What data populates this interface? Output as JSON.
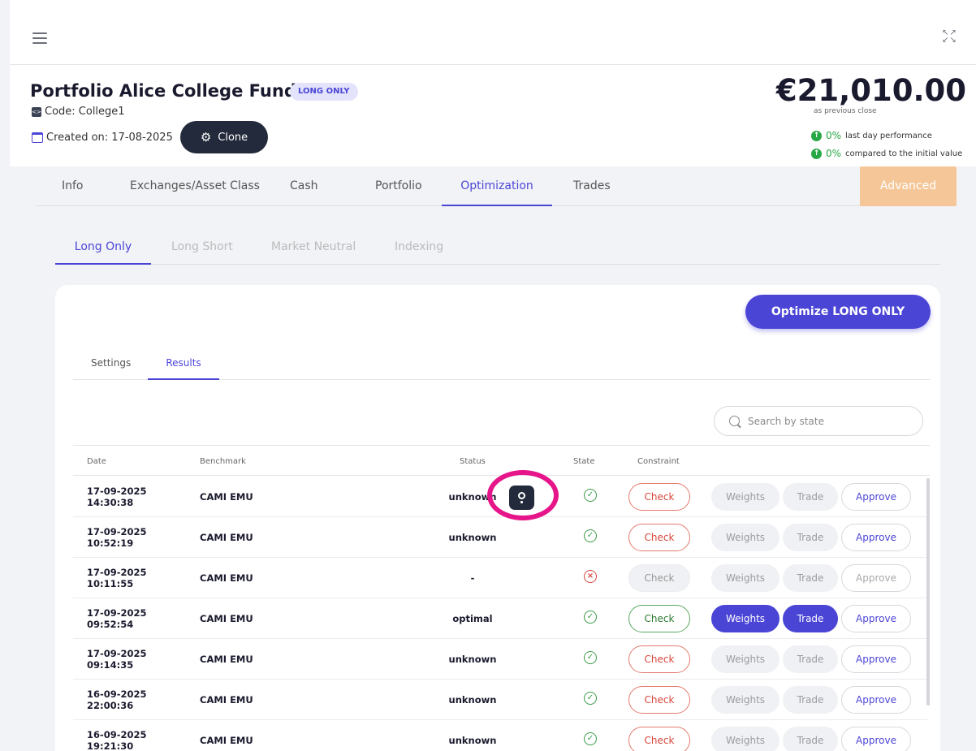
{
  "header": {
    "title": "Portfolio Alice College Fund",
    "badge": "LONG ONLY",
    "code_label": "Code: College1",
    "created_label": "Created on: 17-08-2025",
    "clone_label": "Clone",
    "amount": "€21,010.00",
    "amount_sub": "as previous close",
    "perf_day_pct": "0%",
    "perf_day_label": "last day performance",
    "perf_init_pct": "0%",
    "perf_init_label": "compared to the initial value"
  },
  "tabs": [
    "Info",
    "Exchanges/Asset Class",
    "Cash",
    "Portfolio",
    "Optimization",
    "Trades"
  ],
  "advanced_label": "Advanced",
  "subtabs": [
    "Long Only",
    "Long Short",
    "Market Neutral",
    "Indexing"
  ],
  "optimize_label": "Optimize LONG ONLY",
  "inner_tabs": [
    "Settings",
    "Results"
  ],
  "search": {
    "placeholder": "Search by state"
  },
  "table": {
    "headers": [
      "Date",
      "Benchmark",
      "Status",
      "State",
      "Constraint"
    ],
    "rows": [
      {
        "date": "17-09-2025",
        "time": "14:30:38",
        "benchmark": "CAMI EMU",
        "status": "unknown"
      },
      {
        "date": "17-09-2025",
        "time": "10:52:19",
        "benchmark": "CAMI EMU",
        "status": "unknown"
      },
      {
        "date": "17-09-2025",
        "time": "10:11:55",
        "benchmark": "CAMI EMU",
        "status": "-"
      },
      {
        "date": "17-09-2025",
        "time": "09:52:54",
        "benchmark": "CAMI EMU",
        "status": "optimal"
      },
      {
        "date": "17-09-2025",
        "time": "09:14:35",
        "benchmark": "CAMI EMU",
        "status": "unknown"
      },
      {
        "date": "16-09-2025",
        "time": "22:00:36",
        "benchmark": "CAMI EMU",
        "status": "unknown"
      },
      {
        "date": "16-09-2025",
        "time": "19:21:30",
        "benchmark": "CAMI EMU",
        "status": "unknown"
      }
    ]
  },
  "buttons": {
    "check": "Check",
    "weights": "Weights",
    "trade": "Trade",
    "approve": "Approve"
  },
  "icons": {
    "state_ok": "✓",
    "state_bad": "×",
    "expand": "fullscreen-icon",
    "tooltip": "lightbulb-icon"
  },
  "colors": {
    "accent": "#4b45d6",
    "advanced": "#f5c798",
    "highlight": "#e6158a",
    "success": "#27a745",
    "danger": "#d9463b"
  }
}
